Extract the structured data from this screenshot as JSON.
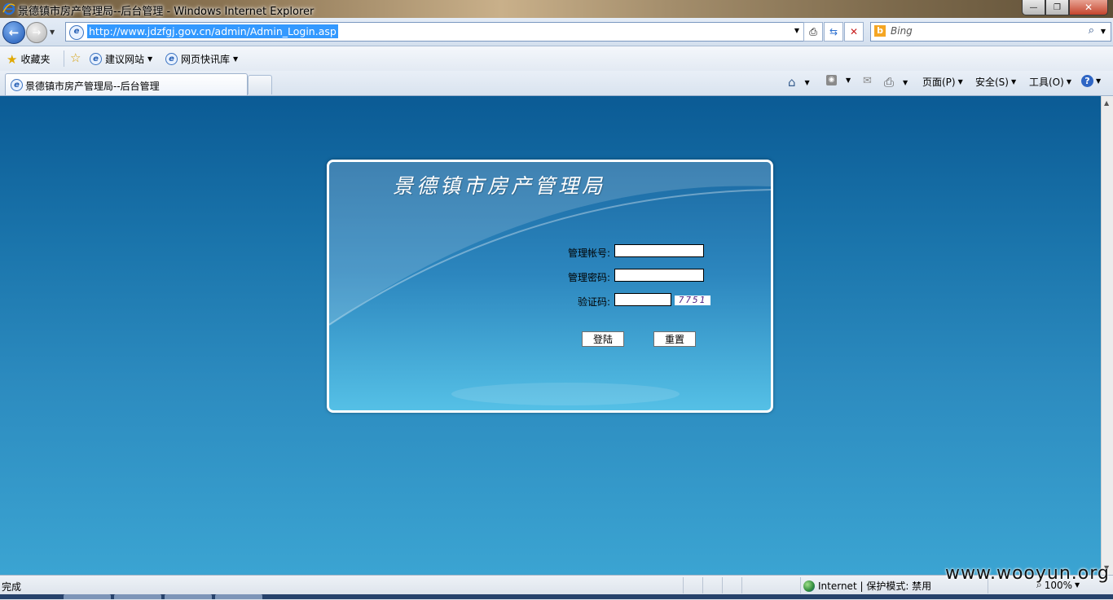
{
  "window": {
    "title": "景德镇市房产管理局--后台管理 - Windows Internet Explorer",
    "controls": {
      "minimize": "—",
      "restore": "❐",
      "close": "✕"
    }
  },
  "address_bar": {
    "url": "http://www.jdzfgj.gov.cn/admin/Admin_Login.asp",
    "search_placeholder": "Bing"
  },
  "favorites_bar": {
    "favorites_label": "收藏夹",
    "items": [
      {
        "label": "建议网站"
      },
      {
        "label": "网页快讯库"
      }
    ]
  },
  "tabs": [
    {
      "label": "景德镇市房产管理局--后台管理",
      "active": true
    }
  ],
  "command_bar": {
    "page": "页面(P)",
    "safety": "安全(S)",
    "tools": "工具(O)",
    "help": "?"
  },
  "login": {
    "title": "景德镇市房产管理局",
    "account_label": "管理帐号:",
    "account_value": "",
    "password_label": "管理密码:",
    "password_value": "",
    "captcha_label": "验证码:",
    "captcha_value": "",
    "captcha_image_text": "7751",
    "login_button": "登陆",
    "reset_button": "重置"
  },
  "status_bar": {
    "status": "完成",
    "zone": "Internet | 保护模式: 禁用",
    "zoom": "100%"
  },
  "watermark": "www.wooyun.org",
  "colors": {
    "page_top": "#0b5b95",
    "page_bottom": "#3ba4d2",
    "panel_border": "#ffffff",
    "url_highlight": "#3399ff"
  }
}
